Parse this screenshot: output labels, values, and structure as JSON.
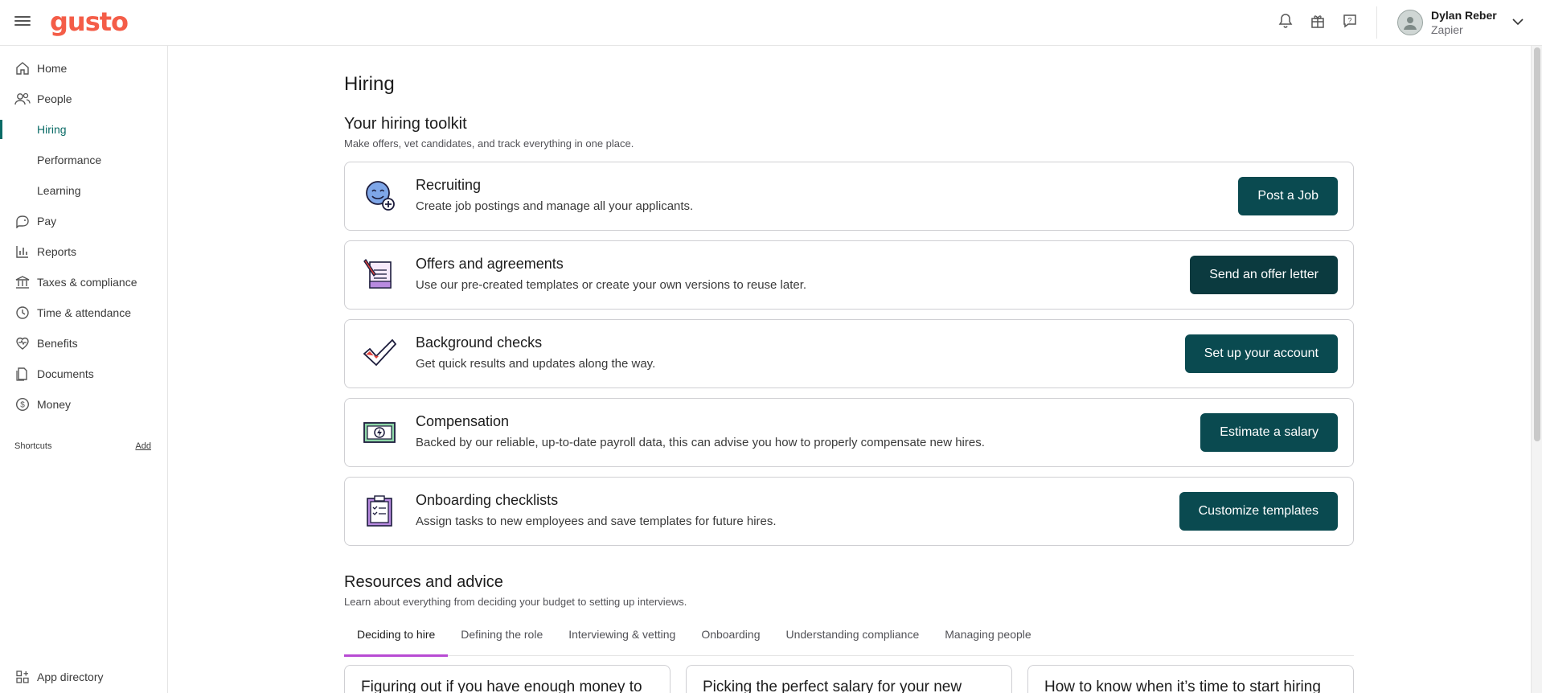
{
  "app": {
    "logo": "gusto"
  },
  "header": {
    "user_name": "Dylan Reber",
    "user_org": "Zapier",
    "icons": [
      "bell-icon",
      "gift-icon",
      "help-icon"
    ]
  },
  "sidebar": {
    "items": [
      {
        "label": "Home",
        "icon": "home-icon"
      },
      {
        "label": "People",
        "icon": "people-icon"
      },
      {
        "label": "Hiring"
      },
      {
        "label": "Performance"
      },
      {
        "label": "Learning"
      },
      {
        "label": "Pay",
        "icon": "pay-icon"
      },
      {
        "label": "Reports",
        "icon": "reports-icon"
      },
      {
        "label": "Taxes & compliance",
        "icon": "bank-icon"
      },
      {
        "label": "Time & attendance",
        "icon": "clock-icon"
      },
      {
        "label": "Benefits",
        "icon": "heart-icon"
      },
      {
        "label": "Documents",
        "icon": "documents-icon"
      },
      {
        "label": "Money",
        "icon": "dollar-icon"
      }
    ],
    "shortcuts_label": "Shortcuts",
    "shortcuts_add": "Add",
    "app_directory": "App directory"
  },
  "main": {
    "page_title": "Hiring",
    "toolkit_title": "Your hiring toolkit",
    "toolkit_subtitle": "Make offers, vet candidates, and track everything in one place.",
    "cards": [
      {
        "title": "Recruiting",
        "desc": "Create job postings and manage all your applicants.",
        "button": "Post a Job",
        "icon": "recruiting-icon"
      },
      {
        "title": "Offers and agreements",
        "desc": "Use our pre-created templates or create your own versions to reuse later.",
        "button": "Send an offer letter",
        "icon": "offer-letter-icon"
      },
      {
        "title": "Background checks",
        "desc": "Get quick results and updates along the way.",
        "button": "Set up your account",
        "icon": "checkmark-icon"
      },
      {
        "title": "Compensation",
        "desc": "Backed by our reliable, up-to-date payroll data, this can advise you how to properly compensate new hires.",
        "button": "Estimate a salary",
        "icon": "money-bill-icon"
      },
      {
        "title": "Onboarding checklists",
        "desc": "Assign tasks to new employees and save templates for future hires.",
        "button": "Customize templates",
        "icon": "clipboard-icon"
      }
    ],
    "resources_title": "Resources and advice",
    "resources_subtitle": "Learn about everything from deciding your budget to setting up interviews.",
    "tabs": [
      "Deciding to hire",
      "Defining the role",
      "Interviewing & vetting",
      "Onboarding",
      "Understanding compliance",
      "Managing people"
    ],
    "articles": [
      "Figuring out if you have enough money to",
      "Picking the perfect salary for your new",
      "How to know when it’s time to start hiring"
    ]
  },
  "colors": {
    "brand": "#f45d48",
    "primary_button": "#0a4a50",
    "active_nav": "#0a6b66",
    "active_tab": "#b84bd3"
  }
}
